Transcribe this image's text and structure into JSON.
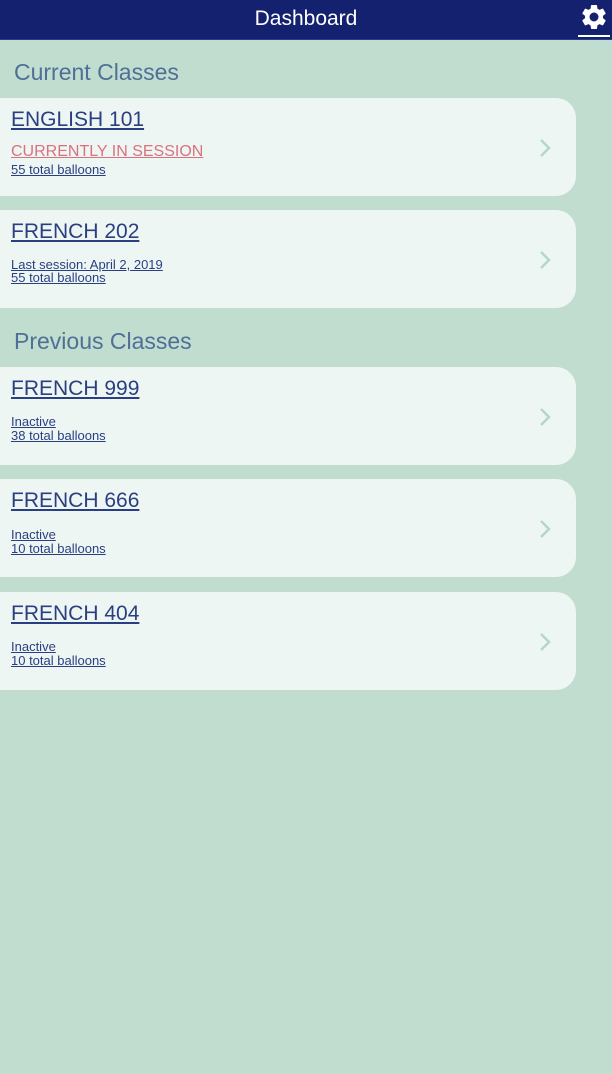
{
  "header": {
    "title": "Dashboard",
    "settings_icon": "gear-icon"
  },
  "colors": {
    "header_bg": "#14216f",
    "page_bg": "#c0ddd0",
    "card_bg": "#eef6f3",
    "link": "#2a3f82",
    "heading": "#4f6f95",
    "in_session": "#d9727e",
    "chevron": "#b5d7c9"
  },
  "current": {
    "heading": "Current Classes",
    "classes": [
      {
        "name": "ENGLISH 101",
        "status": "CURRENTLY IN SESSION",
        "count": "55 total balloons"
      },
      {
        "name": "FRENCH 202",
        "status": "Last session: April 2, 2019",
        "count": "55 total balloons"
      }
    ]
  },
  "previous": {
    "heading": "Previous Classes",
    "classes": [
      {
        "name": "FRENCH 999",
        "status": "Inactive",
        "count": "38 total balloons"
      },
      {
        "name": "FRENCH 666",
        "status": "Inactive",
        "count": "10 total balloons"
      },
      {
        "name": "FRENCH 404",
        "status": "Inactive",
        "count": "10 total balloons"
      }
    ]
  }
}
